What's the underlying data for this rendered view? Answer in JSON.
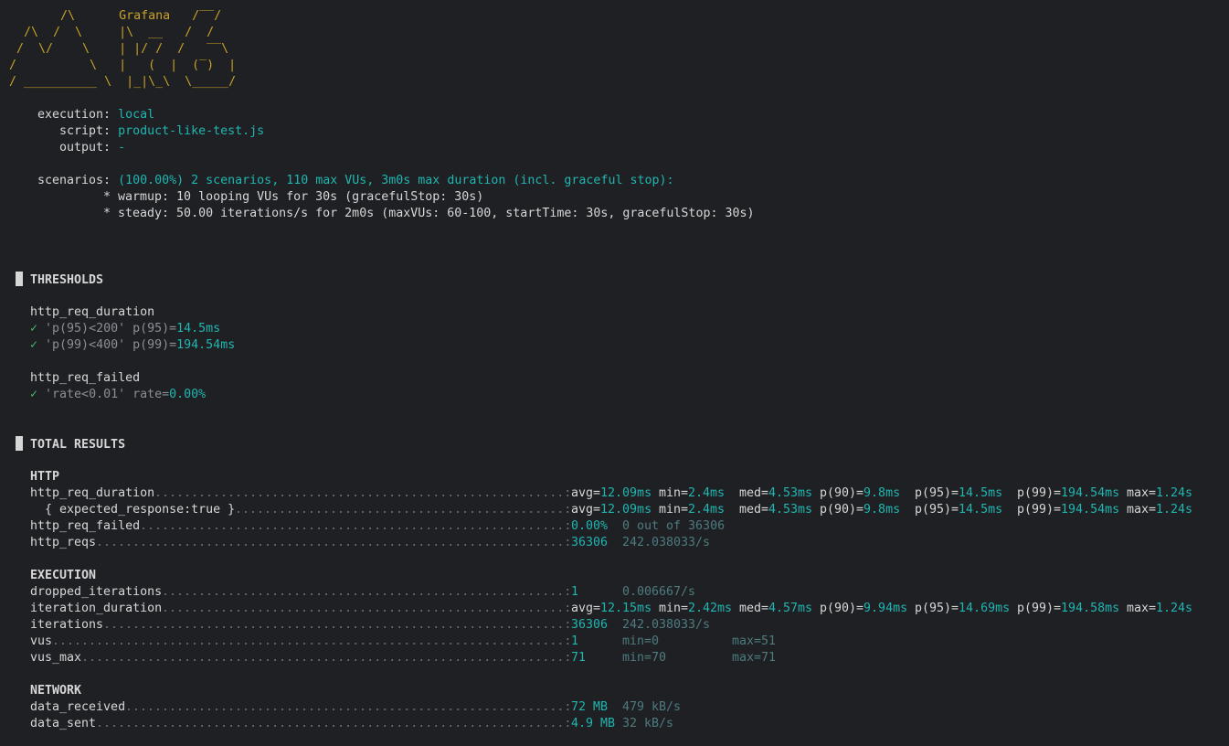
{
  "logo": {
    "lines": [
      "       /\\      Grafana   /‾‾/  ",
      "  /\\  /  \\     |\\  __   /  /   ",
      " /  \\/    \\    | |/ /  /   ‾‾\\ ",
      "/          \\   |   (  |  (‾)  |",
      "/ __________ \\  |_|\\_\\  \\_____/ "
    ]
  },
  "options": {
    "execution_label": "execution:",
    "execution_value": "local",
    "script_label": "script:",
    "script_value": "product-like-test.js",
    "output_label": "output:",
    "output_value": "-",
    "scenarios_label": "scenarios:",
    "scenarios_value": "(100.00%) 2 scenarios, 110 max VUs, 3m0s max duration (incl. graceful stop):",
    "scenario_lines": [
      "* warmup: 10 looping VUs for 30s (gracefulStop: 30s)",
      "* steady: 50.00 iterations/s for 2m0s (maxVUs: 60-100, startTime: 30s, gracefulStop: 30s)"
    ]
  },
  "thresholds": {
    "title": "THRESHOLDS",
    "check_glyph": "✓",
    "groups": [
      {
        "name": "http_req_duration",
        "rules": [
          {
            "rule": "'p(95)<200'",
            "metric": "p(95)=",
            "value": "14.5ms"
          },
          {
            "rule": "'p(99)<400'",
            "metric": "p(99)=",
            "value": "194.54ms"
          }
        ]
      },
      {
        "name": "http_req_failed",
        "rules": [
          {
            "rule": "'rate<0.01'",
            "metric": "rate=",
            "value": "0.00%"
          }
        ]
      }
    ]
  },
  "results": {
    "title": "TOTAL RESULTS",
    "sections": [
      {
        "name": "HTTP",
        "rows": [
          {
            "metric": "http_req_duration",
            "stats": [
              [
                "avg=",
                "12.09ms"
              ],
              [
                "min=",
                "2.4ms"
              ],
              [
                "med=",
                "4.53ms"
              ],
              [
                "p(90)=",
                "9.8ms"
              ],
              [
                "p(95)=",
                "14.5ms"
              ],
              [
                "p(99)=",
                "194.54ms"
              ],
              [
                "max=",
                "1.24s"
              ]
            ]
          },
          {
            "metric": "  { expected_response:true }",
            "stats": [
              [
                "avg=",
                "12.09ms"
              ],
              [
                "min=",
                "2.4ms"
              ],
              [
                "med=",
                "4.53ms"
              ],
              [
                "p(90)=",
                "9.8ms"
              ],
              [
                "p(95)=",
                "14.5ms"
              ],
              [
                "p(99)=",
                "194.54ms"
              ],
              [
                "max=",
                "1.24s"
              ]
            ]
          },
          {
            "metric": "http_req_failed",
            "value": "0.00%",
            "extra": [
              "0 out of 36306"
            ]
          },
          {
            "metric": "http_reqs",
            "value": "36306",
            "extra": [
              "242.038033/s"
            ]
          }
        ]
      },
      {
        "name": "EXECUTION",
        "rows": [
          {
            "metric": "dropped_iterations",
            "value": "1",
            "extra": [
              "0.006667/s"
            ]
          },
          {
            "metric": "iteration_duration",
            "stats": [
              [
                "avg=",
                "12.15ms"
              ],
              [
                "min=",
                "2.42ms"
              ],
              [
                "med=",
                "4.57ms"
              ],
              [
                "p(90)=",
                "9.94ms"
              ],
              [
                "p(95)=",
                "14.69ms"
              ],
              [
                "p(99)=",
                "194.58ms"
              ],
              [
                "max=",
                "1.24s"
              ]
            ]
          },
          {
            "metric": "iterations",
            "value": "36306",
            "extra": [
              "242.038033/s"
            ]
          },
          {
            "metric": "vus",
            "value": "1",
            "extra": [
              "min=0",
              "max=51"
            ]
          },
          {
            "metric": "vus_max",
            "value": "71",
            "extra": [
              "min=70",
              "max=71"
            ]
          }
        ]
      },
      {
        "name": "NETWORK",
        "rows": [
          {
            "metric": "data_received",
            "value": "72 MB",
            "extra": [
              "479 kB/s"
            ]
          },
          {
            "metric": "data_sent",
            "value": "4.9 MB",
            "extra": [
              "32 kB/s"
            ]
          }
        ]
      }
    ]
  }
}
